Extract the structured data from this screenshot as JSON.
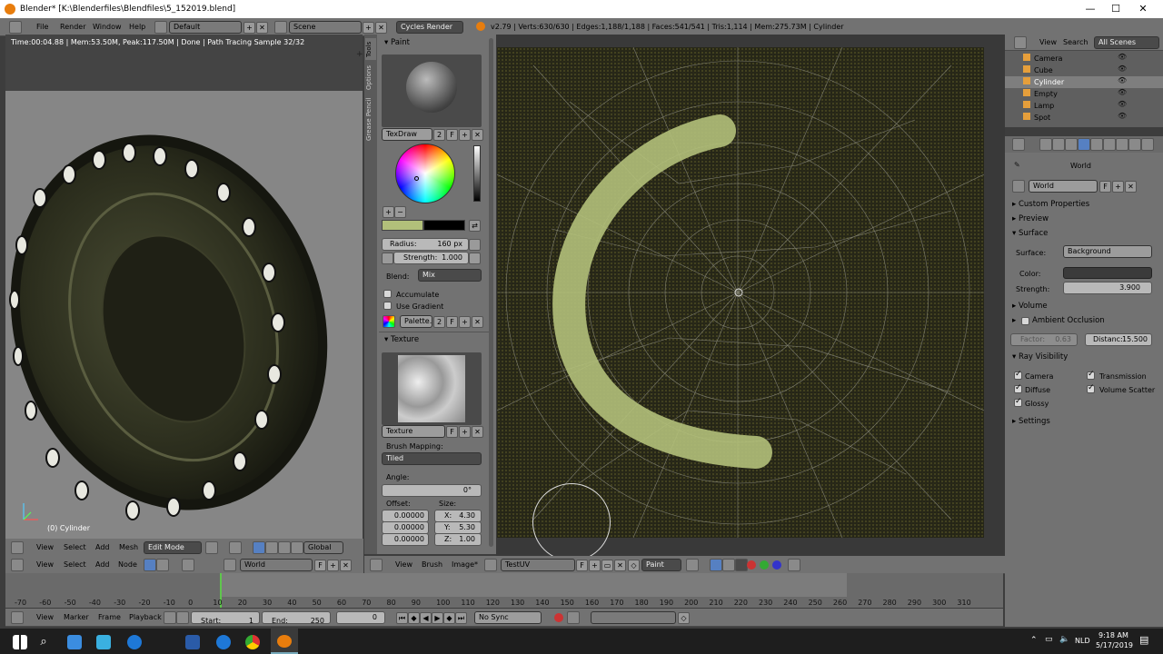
{
  "window": {
    "title": "Blender* [K:\\Blenderfiles\\Blendfiles\\5_152019.blend]"
  },
  "menu": {
    "items": [
      "File",
      "Render",
      "Window",
      "Help"
    ],
    "layout": "Default",
    "scene": "Scene",
    "engine": "Cycles Render",
    "stats": "v2.79 | Verts:630/630 | Edges:1,188/1,188 | Faces:541/541 | Tris:1,114 | Mem:275.73M | Cylinder"
  },
  "viewport3d": {
    "render_info": "Time:00:04.88 | Mem:53.50M, Peak:117.50M | Done | Path Tracing Sample 32/32",
    "object_label": "(0) Cylinder",
    "header": {
      "view": "View",
      "select": "Select",
      "add": "Add",
      "mesh": "Mesh",
      "mode": "Edit Mode",
      "orientation": "Global"
    }
  },
  "node_header": {
    "view": "View",
    "select": "Select",
    "add": "Add",
    "node": "Node",
    "world": "World",
    "world_f": "F"
  },
  "tools": {
    "tabs": [
      "Tools",
      "Options",
      "Grease Pencil"
    ],
    "paint": {
      "title": "Paint",
      "brush": "TexDraw",
      "brush_users": "2",
      "brush_f": "F",
      "radius_label": "Radius:",
      "radius_value": "160 px",
      "strength_label": "Strength:",
      "strength_value": "1.000",
      "blend_label": "Blend:",
      "blend_value": "Mix",
      "accumulate": "Accumulate",
      "use_gradient": "Use Gradient",
      "palette": "Palette.",
      "palette_users": "2",
      "palette_f": "F",
      "color": "#b2c07a"
    },
    "texture": {
      "title": "Texture",
      "name": "Texture",
      "mapping_label": "Brush Mapping:",
      "mapping_value": "Tiled",
      "angle_label": "Angle:",
      "angle_value": "0°",
      "offset_label": "Offset:",
      "size_label": "Size:",
      "offset": [
        "0.00000",
        "0.00000",
        "0.00000"
      ],
      "size_x_label": "X:",
      "size_x": "4.30",
      "size_y_label": "Y:",
      "size_y": "5.30",
      "size_z_label": "Z:",
      "size_z": "1.00"
    }
  },
  "uv_header": {
    "view": "View",
    "brush": "Brush",
    "image": "Image*",
    "image_name": "TestUV",
    "image_f": "F",
    "mode": "Paint"
  },
  "outliner": {
    "view": "View",
    "search": "Search",
    "all_scenes": "All Scenes",
    "items": [
      "Camera",
      "Cube",
      "Cylinder",
      "Empty",
      "Lamp",
      "Spot"
    ]
  },
  "properties": {
    "context": "World",
    "world_name": "World",
    "world_f": "F",
    "panels": {
      "custom": "Custom Properties",
      "preview": "Preview",
      "surface": "Surface",
      "volume": "Volume",
      "ao": "Ambient Occlusion",
      "ray": "Ray Visibility",
      "settings": "Settings"
    },
    "surface_label": "Surface:",
    "surface_value": "Background",
    "color_label": "Color:",
    "strength_label": "Strength:",
    "strength_value": "3.900",
    "factor_label": "Factor:",
    "factor_value": "0.63",
    "distance_label": "Distanc:",
    "distance_value": "15.500",
    "ray": {
      "camera": "Camera",
      "transmission": "Transmission",
      "diffuse": "Diffuse",
      "volume_scatter": "Volume Scatter",
      "glossy": "Glossy"
    }
  },
  "timeline": {
    "ticks": [
      "-70",
      "-60",
      "-50",
      "-40",
      "-30",
      "-20",
      "-10",
      "0",
      "10",
      "20",
      "30",
      "40",
      "50",
      "60",
      "70",
      "80",
      "90",
      "100",
      "110",
      "120",
      "130",
      "140",
      "150",
      "160",
      "170",
      "180",
      "190",
      "200",
      "210",
      "220",
      "230",
      "240",
      "250",
      "260",
      "270",
      "280",
      "290",
      "300",
      "310"
    ],
    "view": "View",
    "marker": "Marker",
    "frame": "Frame",
    "playback": "Playback",
    "start_label": "Start:",
    "start": "1",
    "end_label": "End:",
    "end": "250",
    "current": "0",
    "sync": "No Sync"
  },
  "taskbar": {
    "lang": "NLD",
    "time": "9:18 AM",
    "date": "5/17/2019"
  },
  "colors": {
    "accent": "#5680c2",
    "paint": "#b2c07a"
  }
}
